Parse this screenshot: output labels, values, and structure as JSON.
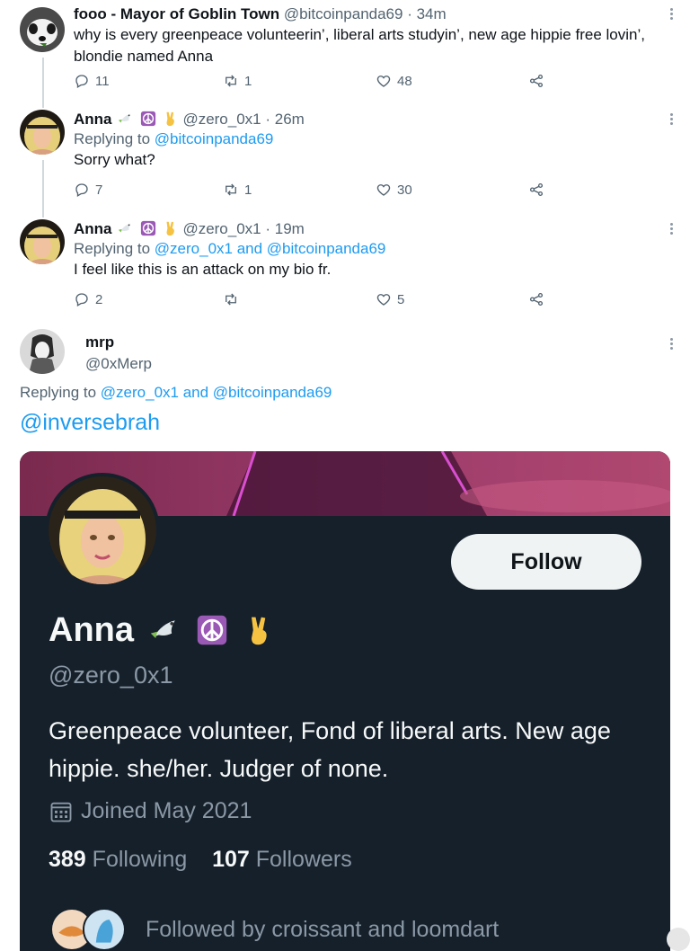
{
  "tweets": [
    {
      "name": "fooo - Mayor of Goblin Town",
      "handle": "@bitcoinpanda69 · 34m",
      "text": "why is every greenpeace volunteerin’, liberal arts studyin’, new age hippie free lovin’, blondie named Anna",
      "replies": "11",
      "retweets": "1",
      "likes": "48"
    },
    {
      "name": "Anna",
      "handle": "@zero_0x1 · 26m",
      "reply_prefix": "Replying to",
      "reply_targets": "@bitcoinpanda69",
      "text": "Sorry what?",
      "replies": "7",
      "retweets": "1",
      "likes": "30"
    },
    {
      "name": "Anna",
      "handle": "@zero_0x1 · 19m",
      "reply_prefix": "Replying to",
      "reply_targets": "@zero_0x1 and @bitcoinpanda69",
      "text": "I feel like this is an attack on my bio fr.",
      "replies": "2",
      "retweets": "",
      "likes": "5"
    }
  ],
  "main_tweet": {
    "name": "mrp",
    "handle": "@0xMerp",
    "reply_prefix": "Replying to",
    "reply_targets": "@zero_0x1 and @bitcoinpanda69",
    "text": "@inversebrah"
  },
  "profile_card": {
    "follow_label": "Follow",
    "name": "Anna",
    "handle": "@zero_0x1",
    "bio": "Greenpeace volunteer, Fond of liberal arts. New age hippie. she/her. Judger of none.",
    "joined": "Joined May 2021",
    "following_count": "389",
    "following_label": "Following",
    "followers_count": "107",
    "followers_label": "Followers",
    "followed_by": "Followed by croissant and loomdart"
  },
  "icons": {
    "reply": "reply-icon",
    "retweet": "retweet-icon",
    "like": "heart-icon",
    "share": "share-icon",
    "more": "more-options-icon",
    "calendar": "calendar-icon",
    "emoji": [
      "dove-emoji",
      "peace-symbol-emoji",
      "victory-hand-emoji"
    ]
  },
  "colors": {
    "accent": "#1d9bf0",
    "secondary_text": "#536471",
    "card_background": "#15202b"
  }
}
